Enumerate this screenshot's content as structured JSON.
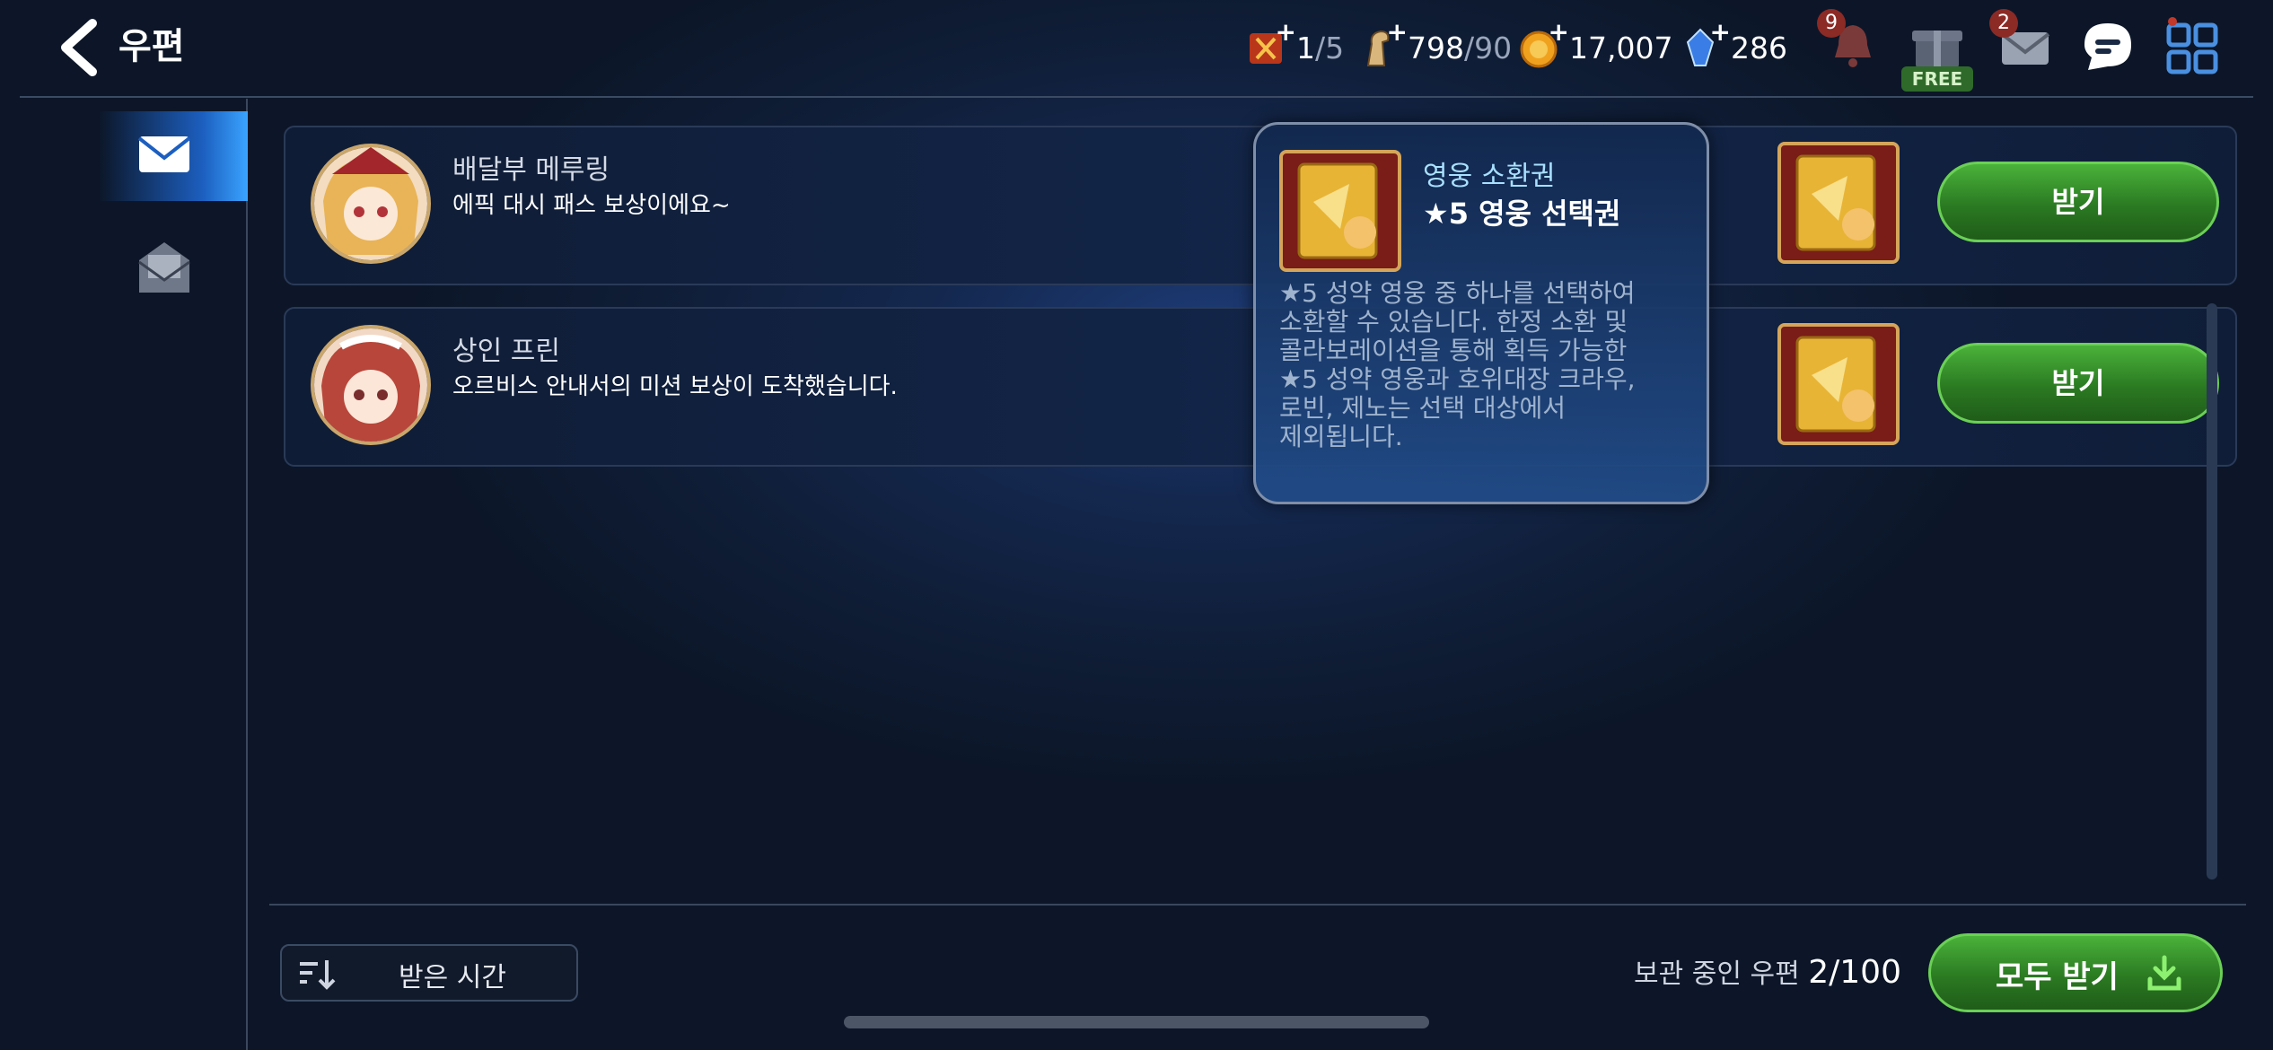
{
  "header": {
    "title": "우편"
  },
  "resources": [
    {
      "name": "stamina-ticket",
      "current": "1",
      "max": "/5"
    },
    {
      "name": "horse-stamina",
      "current": "798",
      "max": "/90"
    },
    {
      "name": "gold",
      "current": "17,007",
      "max": ""
    },
    {
      "name": "crystal",
      "current": "286",
      "max": ""
    }
  ],
  "hud": {
    "notification_badge": "9",
    "mail_badge": "2",
    "free_label": "FREE"
  },
  "mails": [
    {
      "sender": "배달부 메루링",
      "message": "에픽 대시 패스 보상이에요~",
      "button": "받기"
    },
    {
      "sender": "상인 프린",
      "message": "오르비스 안내서의 미션 보상이 도착했습니다.",
      "button": "받기"
    }
  ],
  "tooltip": {
    "category": "영웅 소환권",
    "name": "★5 영웅 선택권",
    "description": "★5 성약 영웅 중 하나를 선택하여\n소환할 수 있습니다. 한정 소환 및\n콜라보레이션을 통해 획득 가능한\n★5 성약 영웅과 호위대장 크라우,\n로빈, 제노는 선택 대상에서\n제외됩니다."
  },
  "footer": {
    "sort_label": "받은 시간",
    "storage_label": "보관 중인 우편",
    "storage_count": "2/100",
    "receive_all": "모두 받기"
  },
  "colors": {
    "accent_green": "#2b7a22",
    "tab_active": "#1c5fc0"
  }
}
